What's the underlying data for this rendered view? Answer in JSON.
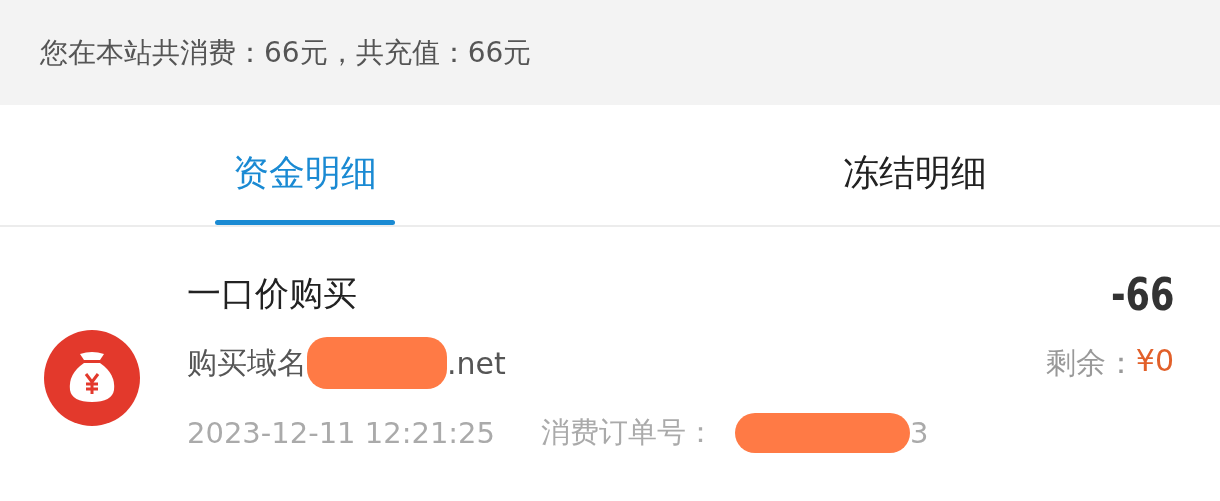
{
  "summary": "您在本站共消费：66元，共充值：66元",
  "tabs": [
    {
      "label": "资金明细",
      "selected": true
    },
    {
      "label": "冻结明细",
      "selected": false
    }
  ],
  "records": [
    {
      "title": "一口价购买",
      "amount": "-66",
      "description": {
        "before": "购买域名",
        "redacted": true,
        "after": ".net"
      },
      "balance_label": "剩余：",
      "balance": "¥0",
      "time": "2023-12-11 12:21:25",
      "order_label": "消费订单号：",
      "order": {
        "redacted": true,
        "after": "3"
      }
    }
  ]
}
